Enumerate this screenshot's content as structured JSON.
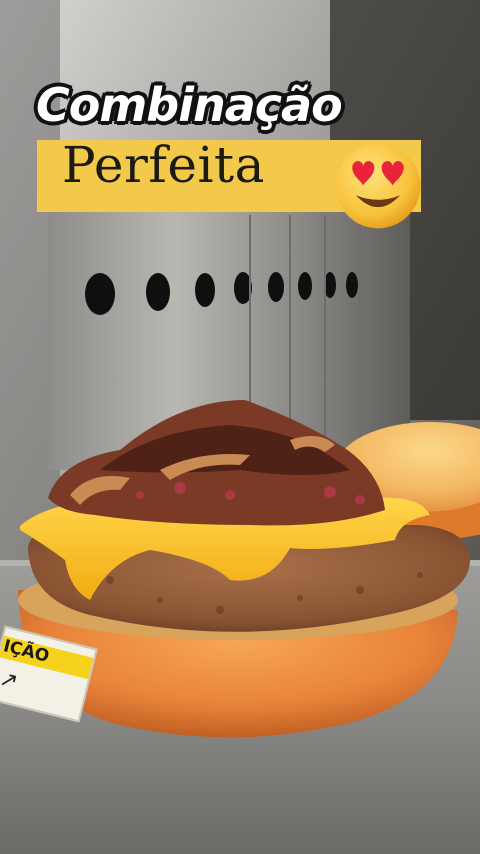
{
  "headline": {
    "line1": "Combinação",
    "line2": "Perfeita"
  },
  "emoji": {
    "icon": "smiling-face-with-heart-eyes"
  },
  "sticker": {
    "text": "IÇÃO",
    "arrow": "↗"
  },
  "colors": {
    "banner": "#f2c94a",
    "bun": "#e8843a",
    "cheese": "#f7c21a",
    "patty": "#8a5433",
    "sauce": "#5a2a1c",
    "steel": "#a8a7a4"
  }
}
